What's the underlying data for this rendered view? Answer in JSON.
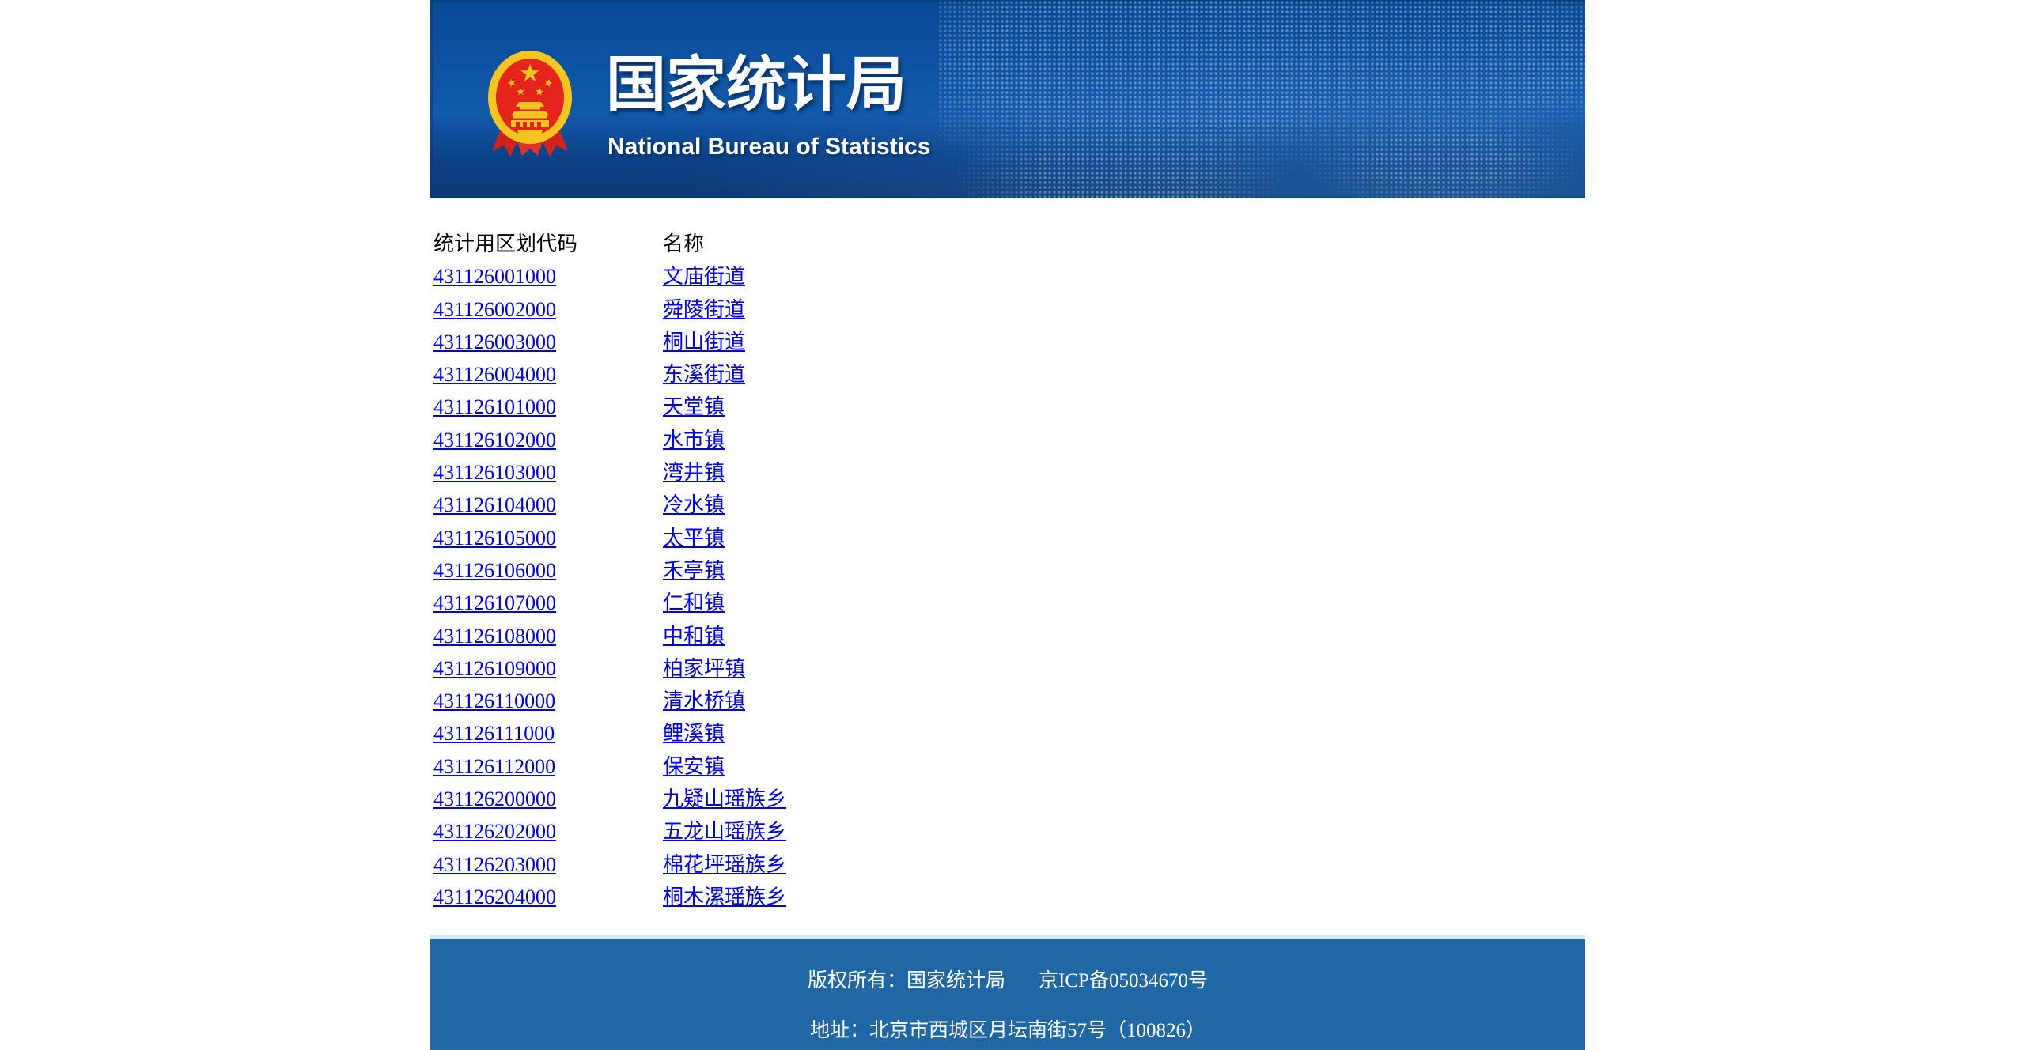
{
  "banner": {
    "title_cn": "国家统计局",
    "title_en": "National Bureau of Statistics",
    "emblem": "china-national-emblem"
  },
  "table": {
    "headers": [
      "统计用区划代码",
      "名称"
    ],
    "rows": [
      {
        "code": "431126001000",
        "name": "文庙街道"
      },
      {
        "code": "431126002000",
        "name": "舜陵街道"
      },
      {
        "code": "431126003000",
        "name": "桐山街道"
      },
      {
        "code": "431126004000",
        "name": "东溪街道"
      },
      {
        "code": "431126101000",
        "name": "天堂镇"
      },
      {
        "code": "431126102000",
        "name": "水市镇"
      },
      {
        "code": "431126103000",
        "name": "湾井镇"
      },
      {
        "code": "431126104000",
        "name": "冷水镇"
      },
      {
        "code": "431126105000",
        "name": "太平镇"
      },
      {
        "code": "431126106000",
        "name": "禾亭镇"
      },
      {
        "code": "431126107000",
        "name": "仁和镇"
      },
      {
        "code": "431126108000",
        "name": "中和镇"
      },
      {
        "code": "431126109000",
        "name": "柏家坪镇"
      },
      {
        "code": "431126110000",
        "name": "清水桥镇"
      },
      {
        "code": "431126111000",
        "name": "鲤溪镇"
      },
      {
        "code": "431126112000",
        "name": "保安镇"
      },
      {
        "code": "431126200000",
        "name": "九疑山瑶族乡"
      },
      {
        "code": "431126202000",
        "name": "五龙山瑶族乡"
      },
      {
        "code": "431126203000",
        "name": "棉花坪瑶族乡"
      },
      {
        "code": "431126204000",
        "name": "桐木漯瑶族乡"
      }
    ]
  },
  "footer": {
    "copyright": "版权所有：国家统计局",
    "icp": "京ICP备05034670号",
    "address": "地址：北京市西城区月坛南街57号（100826）"
  },
  "colors": {
    "link": "#0000ee",
    "footer_bg": "#2067a5",
    "footer_strip": "#d6e8f8",
    "banner_top": "#094a96",
    "banner_mid": "#1159a9",
    "banner_bottom": "#0b3a74",
    "emblem_gold": "#f5c41f",
    "emblem_red": "#e5251b"
  }
}
